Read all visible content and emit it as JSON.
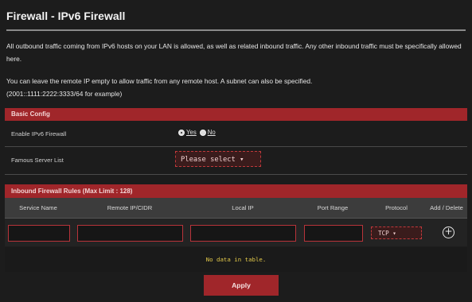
{
  "page": {
    "title": "Firewall - IPv6 Firewall",
    "description1": "All outbound traffic coming from IPv6 hosts on your LAN is allowed, as well as related inbound traffic. Any other inbound traffic must be specifically allowed here.",
    "description2_line1": "You can leave the remote IP empty to allow traffic from any remote host. A subnet can also be specified.",
    "description2_line2": "(2001::1111:2222:3333/64 for example)"
  },
  "basic_config": {
    "section_title": "Basic Config",
    "enable_label": "Enable IPv6 Firewall",
    "enable_yes": "Yes",
    "enable_no": "No",
    "enable_value": "Yes",
    "famous_label": "Famous Server List",
    "famous_select": "Please select ▾"
  },
  "inbound": {
    "section_title": "Inbound Firewall Rules (Max Limit : 128)",
    "columns": [
      "Service Name",
      "Remote IP/CIDR",
      "Local IP",
      "Port Range",
      "Protocol",
      "Add / Delete"
    ],
    "protocol_value": "TCP ▾",
    "add_symbol": "+",
    "empty_message": "No data in table."
  },
  "footer": {
    "apply_label": "Apply"
  },
  "colors": {
    "accent": "#a0262a",
    "background": "#1c1c1c",
    "empty_text": "#e3c94a"
  }
}
